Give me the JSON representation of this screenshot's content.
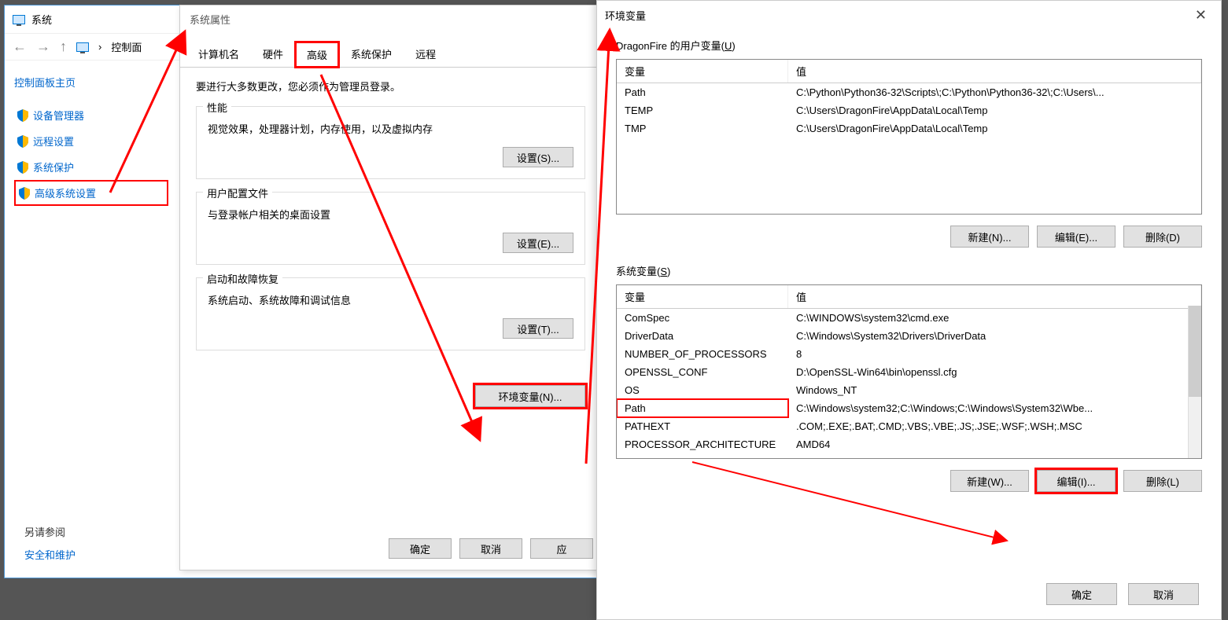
{
  "sys": {
    "title": "系统",
    "breadcrumb": "控制面",
    "sidebar": {
      "heading": "控制面板主页",
      "items": [
        "设备管理器",
        "远程设置",
        "系统保护",
        "高级系统设置"
      ],
      "footer_heading": "另请参阅",
      "footer_link": "安全和维护"
    }
  },
  "props": {
    "title": "系统属性",
    "tabs": [
      "计算机名",
      "硬件",
      "高级",
      "系统保护",
      "远程"
    ],
    "intro": "要进行大多数更改，您必须作为管理员登录。",
    "groups": [
      {
        "title": "性能",
        "desc": "视觉效果，处理器计划，内存使用，以及虚拟内存",
        "btn": "设置(S)..."
      },
      {
        "title": "用户配置文件",
        "desc": "与登录帐户相关的桌面设置",
        "btn": "设置(E)..."
      },
      {
        "title": "启动和故障恢复",
        "desc": "系统启动、系统故障和调试信息",
        "btn": "设置(T)..."
      }
    ],
    "env_btn": "环境变量(N)...",
    "footer": {
      "ok": "确定",
      "cancel": "取消",
      "apply": "应"
    }
  },
  "env": {
    "title": "环境变量",
    "user_label_prefix": "DragonFire 的用户变量(",
    "user_label_key": "U",
    "user_label_suffix": ")",
    "sys_label_prefix": "系统变量(",
    "sys_label_key": "S",
    "sys_label_suffix": ")",
    "col_var": "变量",
    "col_val": "值",
    "user_vars": [
      {
        "name": "Path",
        "value": "C:\\Python\\Python36-32\\Scripts\\;C:\\Python\\Python36-32\\;C:\\Users\\..."
      },
      {
        "name": "TEMP",
        "value": "C:\\Users\\DragonFire\\AppData\\Local\\Temp"
      },
      {
        "name": "TMP",
        "value": "C:\\Users\\DragonFire\\AppData\\Local\\Temp"
      }
    ],
    "sys_vars": [
      {
        "name": "ComSpec",
        "value": "C:\\WINDOWS\\system32\\cmd.exe"
      },
      {
        "name": "DriverData",
        "value": "C:\\Windows\\System32\\Drivers\\DriverData"
      },
      {
        "name": "NUMBER_OF_PROCESSORS",
        "value": "8"
      },
      {
        "name": "OPENSSL_CONF",
        "value": "D:\\OpenSSL-Win64\\bin\\openssl.cfg"
      },
      {
        "name": "OS",
        "value": "Windows_NT"
      },
      {
        "name": "Path",
        "value": "C:\\Windows\\system32;C:\\Windows;C:\\Windows\\System32\\Wbe..."
      },
      {
        "name": "PATHEXT",
        "value": ".COM;.EXE;.BAT;.CMD;.VBS;.VBE;.JS;.JSE;.WSF;.WSH;.MSC"
      },
      {
        "name": "PROCESSOR_ARCHITECTURE",
        "value": "AMD64"
      }
    ],
    "btns": {
      "new_u": "新建(N)...",
      "edit_u": "编辑(E)...",
      "del_u": "删除(D)",
      "new_s": "新建(W)...",
      "edit_s": "编辑(I)...",
      "del_s": "删除(L)",
      "ok": "确定",
      "cancel": "取消"
    }
  }
}
